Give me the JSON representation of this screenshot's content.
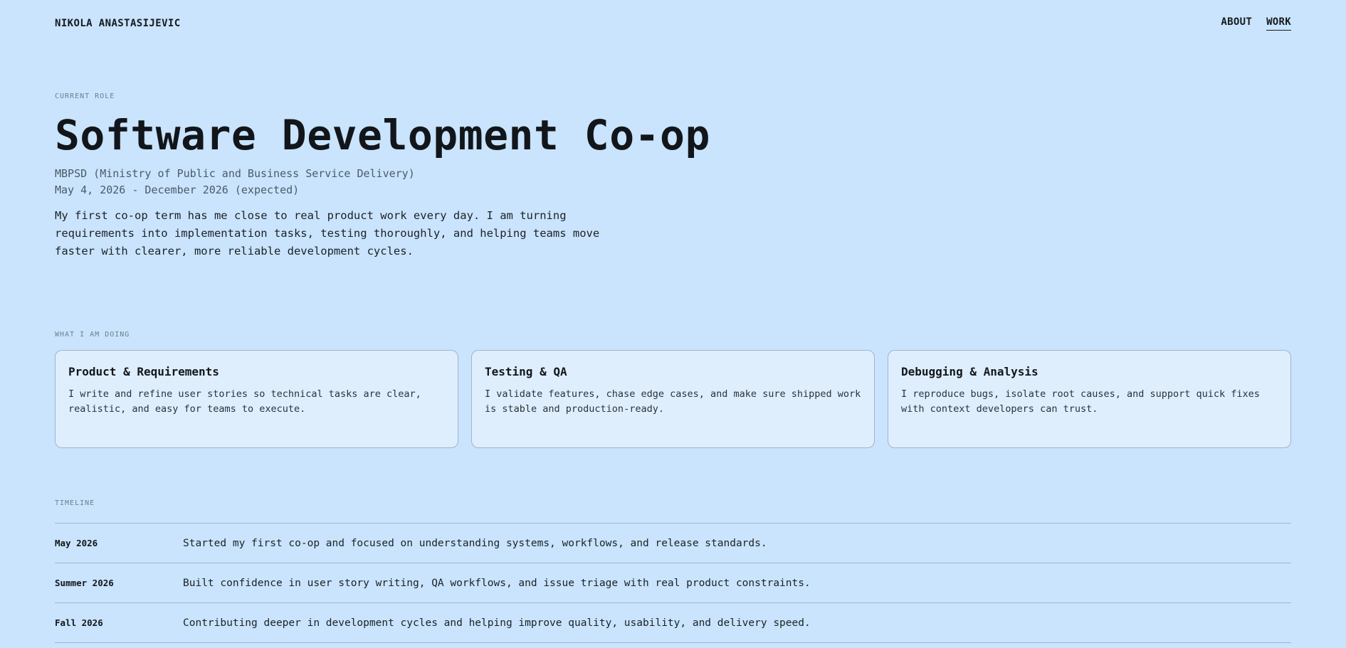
{
  "header": {
    "brand": "NIKOLA ANASTASIJEVIC",
    "nav": [
      {
        "label": "ABOUT",
        "active": false
      },
      {
        "label": "WORK",
        "active": true
      }
    ]
  },
  "hero": {
    "eyebrow": "CURRENT ROLE",
    "title": "Software Development Co-op",
    "organization": "MBPSD (Ministry of Public and Business Service Delivery)",
    "dates": "May 4, 2026 - December 2026 (expected)",
    "description": "My first co-op term has me close to real product work every day. I am turning requirements into implementation tasks, testing thoroughly, and helping teams move faster with clearer, more reliable development cycles."
  },
  "doing": {
    "eyebrow": "WHAT I AM DOING",
    "cards": [
      {
        "title": "Product & Requirements",
        "text": "I write and refine user stories so technical tasks are clear, realistic, and easy for teams to execute."
      },
      {
        "title": "Testing & QA",
        "text": "I validate features, chase edge cases, and make sure shipped work is stable and production-ready."
      },
      {
        "title": "Debugging & Analysis",
        "text": "I reproduce bugs, isolate root causes, and support quick fixes with context developers can trust."
      }
    ]
  },
  "timeline": {
    "eyebrow": "TIMELINE",
    "entries": [
      {
        "date": "May 2026",
        "text": "Started my first co-op and focused on understanding systems, workflows, and release standards."
      },
      {
        "date": "Summer 2026",
        "text": "Built confidence in user story writing, QA workflows, and issue triage with real product constraints."
      },
      {
        "date": "Fall 2026",
        "text": "Contributing deeper in development cycles and helping improve quality, usability, and delivery speed."
      }
    ]
  },
  "colors": {
    "background": "#c9e4fc",
    "card_background": "#deeefd",
    "border": "#9fb6cc",
    "text": "#161a1f",
    "muted": "#6e7f90"
  }
}
